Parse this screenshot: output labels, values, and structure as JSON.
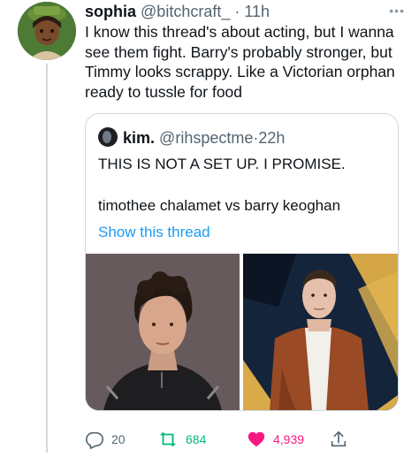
{
  "author": {
    "name": "sophia",
    "handle": "@bitchcraft_",
    "dot": "·",
    "time": "11h"
  },
  "more_label": "•••",
  "tweet": {
    "text": "I know this thread's about acting, but I wanna see them fight. Barry's probably stronger, but Timmy looks scrappy. Like a Victorian orphan ready to tussle for food"
  },
  "quoted": {
    "name": "kim.",
    "handle": "@rihspectme",
    "dot": "·",
    "time": "22h",
    "line1": "THIS IS NOT A SET UP. I PROMISE.",
    "line2": "timothee chalamet vs barry keoghan",
    "show_thread": "Show this thread",
    "photos": [
      "timothee-photo",
      "barry-photo"
    ]
  },
  "actions": {
    "replies": "20",
    "retweets": "684",
    "likes": "4,939"
  },
  "colors": {
    "link": "#1d9bf0",
    "retweet": "#00ba7c",
    "like": "#f91880",
    "muted": "#536471",
    "border": "#cfd9de"
  },
  "icons": [
    "reply-icon",
    "retweet-icon",
    "heart-icon",
    "share-icon",
    "more-icon"
  ]
}
